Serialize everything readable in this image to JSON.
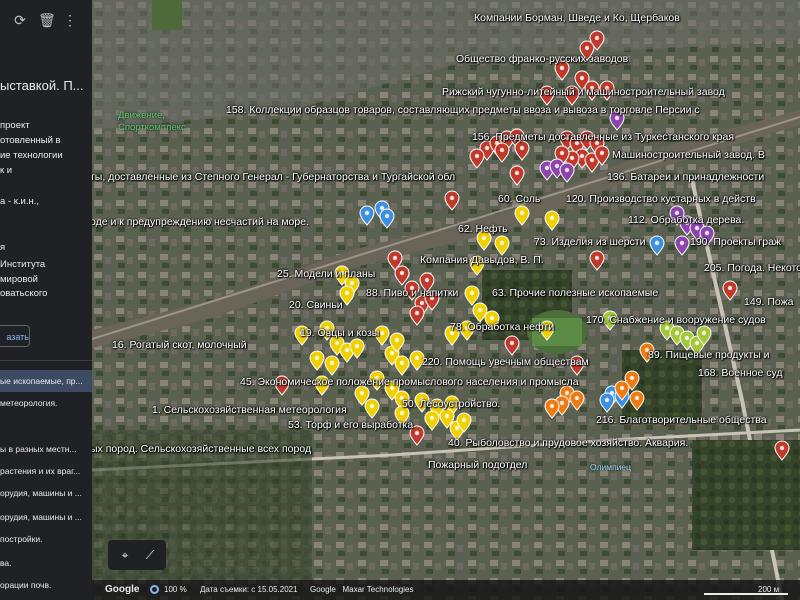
{
  "sidebar": {
    "title": "ыставкой. П...",
    "description_lines": [
      "проект",
      "отовленный в",
      "ие технологии",
      "к и",
      "а - к.и.н.,",
      "я",
      "Института",
      "мировой",
      "оватьского"
    ],
    "show_button": "азать",
    "items": [
      {
        "label": "ые ископаемые, пр...",
        "selected": true
      },
      {
        "label": "метеорология."
      },
      {
        "label": "ы в разных местн..."
      },
      {
        "label": "растения и их враг..."
      },
      {
        "label": "орудия, машины и ..."
      },
      {
        "label": "орудия, машины и ..."
      },
      {
        "label": "постройки."
      },
      {
        "label": "ва."
      },
      {
        "label": "орации почв."
      }
    ],
    "icons": [
      "sync-icon",
      "trash-icon",
      "more-vert-icon"
    ]
  },
  "map": {
    "labels": [
      "Компании Борман, Шведе и Ко, Щербаков",
      "Общество франко-русских заводов",
      "Рижский чугунно-литейный и машиностроительный завод",
      "158. Коллекции образцов товаров, составляющих предметы ввоза и вывоза в торговле Персии с",
      "156. Предметы доставленные из Туркестанского края",
      "Машиностроительный завод. В",
      "ты, доставленные из Степного Генерал - Губернаторства и Тургайской обл",
      "136. Батареи и принадлежности",
      "60. Соль",
      "120. Производство кустарных в действ",
      "оде и к предупреждению несчастий на море.",
      "62. Нефть",
      "112. Обработка дерева.",
      "73. Изделия из шерсти",
      "190. Проекты граж",
      "Компания Давыдов, В. П.",
      "205. Погода. Некотор",
      "25. Модели и планы",
      "88. Пиво и напитки",
      "63. Прочие полезные ископаемые",
      "149. Пожа",
      "20. Свиньи",
      "170. Снабжение и вооружение судов",
      "19. Овцы и козы",
      "78. Обработка нефти",
      "16. Рогатый скот, молочный",
      "220. Помощь увечным обществам",
      "89. Пищевые продукты и",
      "168. Военное суд",
      "45. Экономическое положение промыслового населения и промысла",
      "50. Лесоустройство.",
      "1. Сельскохозяйственная метеорология",
      "53. Торф и его выработка",
      "216. Благотворительные общества",
      "ых пород. Сельскохозяйственные всех пород",
      "40. Рыболовство и прудовое хозяйство. Аквария.",
      "Пожарный подотдел"
    ],
    "poi": [
      "Движение,",
      "Спорткомплекс"
    ],
    "poi2": "Олимпиец"
  },
  "bottom": {
    "brand": "Google",
    "zoom": "100 %",
    "date": "Дата съемки: с 15.05.2021",
    "attribution": "Google   Maxar Technologies",
    "scale": "200 м"
  },
  "colors": {
    "red": "#c0392b",
    "yellow": "#f0d000",
    "purple": "#8e44ad",
    "blue": "#3d8fe0",
    "orange": "#f07a12",
    "lime": "#a4c639"
  }
}
